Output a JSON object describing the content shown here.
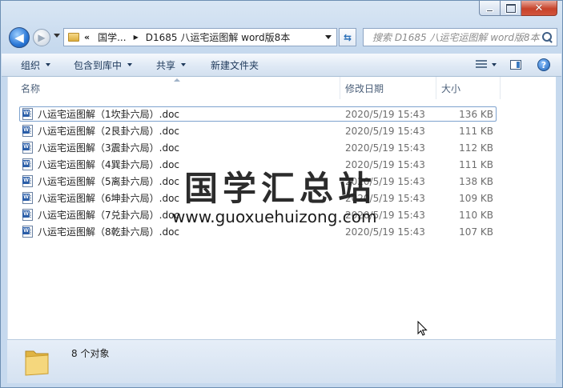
{
  "caption": {
    "minimize": "—",
    "maximize": "",
    "close": "✕"
  },
  "nav": {
    "back_glyph": "◀",
    "forward_glyph": "▶",
    "address_chevron": "«",
    "breadcrumb": [
      "国学...",
      "D1685 八运宅运图解 word版8本"
    ],
    "breadcrumb_sep": "▶",
    "refresh_glyph": "⇆",
    "search_placeholder": "搜索 D1685 八运宅运图解 word版8本"
  },
  "toolbar": {
    "organize": "组织",
    "include_in_library": "包含到库中",
    "share": "共享",
    "new_folder": "新建文件夹",
    "help": "?"
  },
  "columns": {
    "name": "名称",
    "date": "修改日期",
    "size": "大小"
  },
  "files": [
    {
      "name": "八运宅运图解（1坎卦六局）.doc",
      "date": "2020/5/19 15:43",
      "size": "136 KB"
    },
    {
      "name": "八运宅运图解（2艮卦六局）.doc",
      "date": "2020/5/19 15:43",
      "size": "111 KB"
    },
    {
      "name": "八运宅运图解（3震卦六局）.doc",
      "date": "2020/5/19 15:43",
      "size": "112 KB"
    },
    {
      "name": "八运宅运图解（4巽卦六局）.doc",
      "date": "2020/5/19 15:43",
      "size": "111 KB"
    },
    {
      "name": "八运宅运图解（5离卦六局）.doc",
      "date": "2020/5/19 15:43",
      "size": "138 KB"
    },
    {
      "name": "八运宅运图解（6坤卦六局）.doc",
      "date": "2020/5/19 15:43",
      "size": "109 KB"
    },
    {
      "name": "八运宅运图解（7兑卦六局）.doc",
      "date": "2020/5/19 15:43",
      "size": "110 KB"
    },
    {
      "name": "八运宅运图解（8乾卦六局）.doc",
      "date": "2020/5/19 15:43",
      "size": "107 KB"
    }
  ],
  "watermark": {
    "title": "国学汇总站",
    "url": "www.guoxuehuizong.com"
  },
  "status": {
    "count": "8 个对象"
  }
}
